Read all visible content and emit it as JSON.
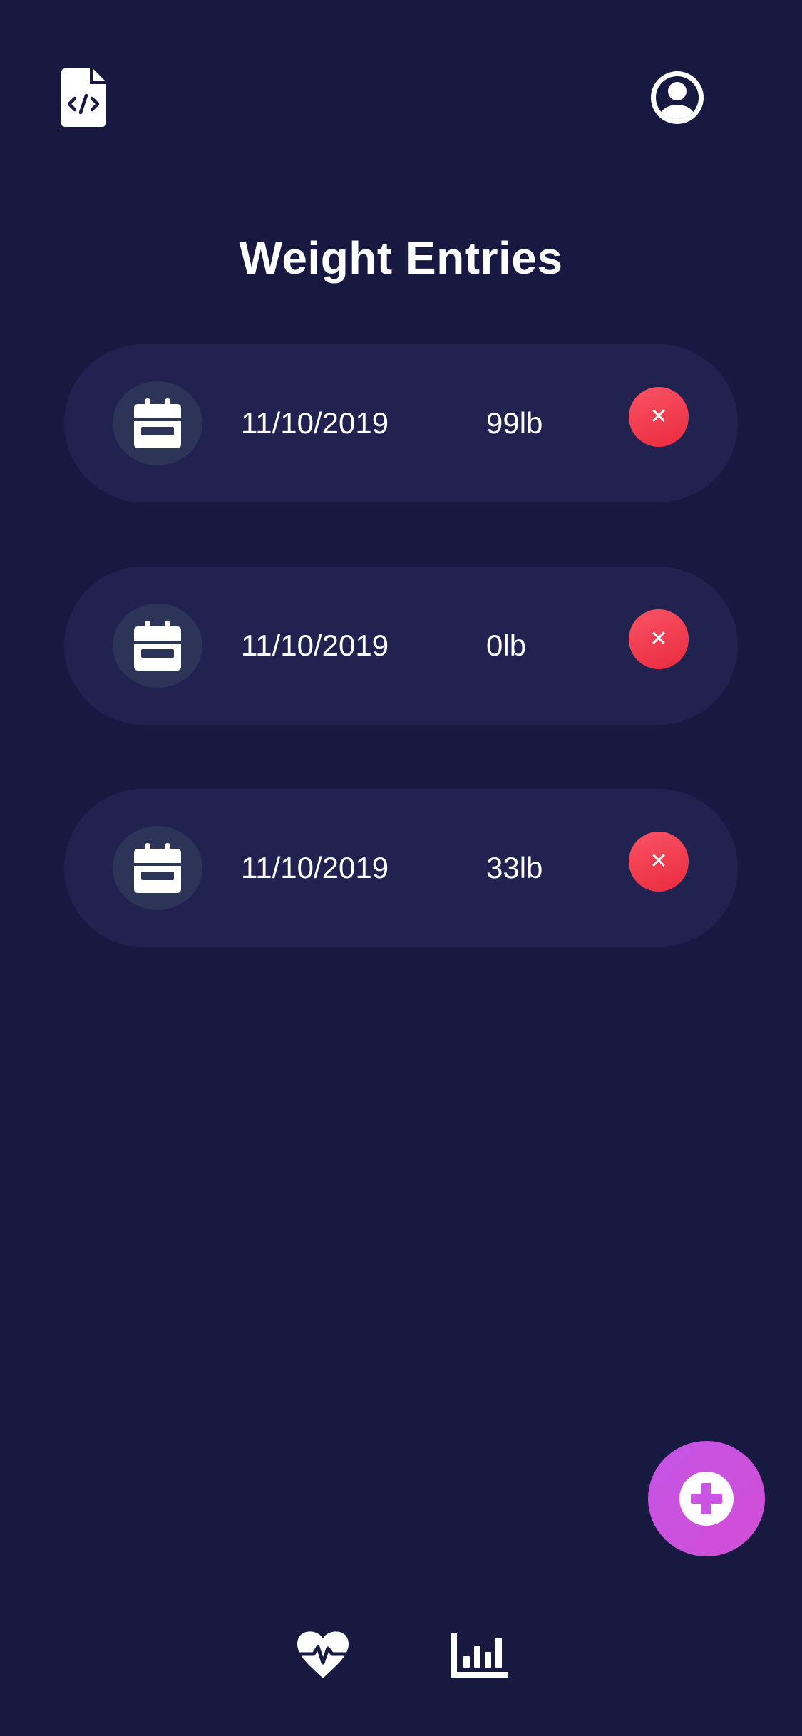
{
  "header": {
    "title": "Weight Entries",
    "left_icon": "file-code-icon",
    "right_icon": "user-circle-icon"
  },
  "entries": [
    {
      "date": "11/10/2019",
      "weight": "99lb",
      "delete_label": "✕"
    },
    {
      "date": "11/10/2019",
      "weight": "0lb",
      "delete_label": "✕"
    },
    {
      "date": "11/10/2019",
      "weight": "33lb",
      "delete_label": "✕"
    }
  ],
  "fab": {
    "icon": "plus-circle-icon"
  },
  "bottom_nav": [
    {
      "icon": "heartbeat-icon"
    },
    {
      "icon": "bar-chart-icon"
    }
  ],
  "colors": {
    "background": "#181940",
    "card": "#212250",
    "icon_circle": "#2c3557",
    "delete": "#f0384b",
    "fab": "#c955e0"
  }
}
